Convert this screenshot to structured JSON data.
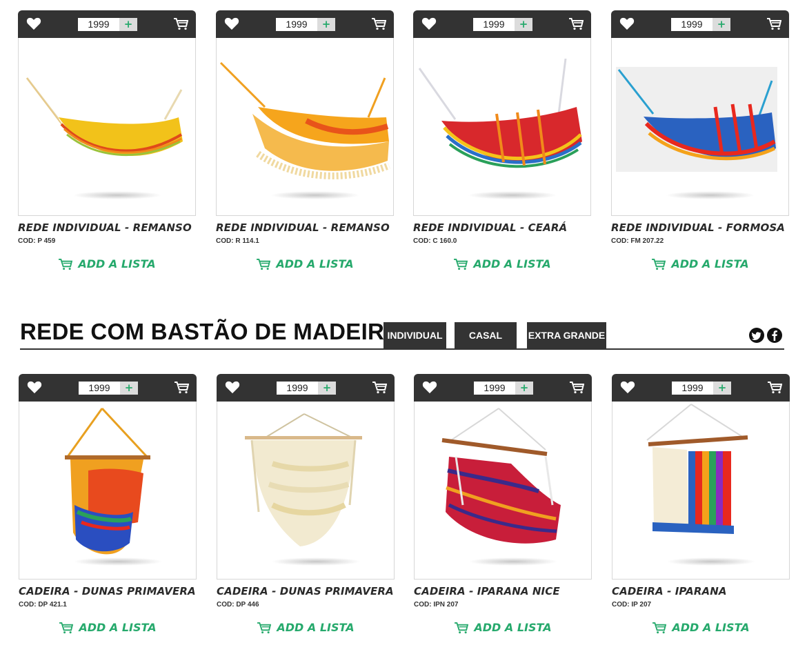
{
  "colors": {
    "accent": "#26a96c",
    "dark_bar": "#333333"
  },
  "row1": [
    {
      "qty": "1999",
      "title": "REDE INDIVIDUAL - REMANSO",
      "code": "COD: P 459",
      "add": "ADD A LISTA"
    },
    {
      "qty": "1999",
      "title": "REDE INDIVIDUAL - REMANSO",
      "code": "COD:  R 114.1",
      "add": "ADD A LISTA"
    },
    {
      "qty": "1999",
      "title": "REDE INDIVIDUAL - CEARÁ",
      "code": "COD: C 160.0",
      "add": "ADD A LISTA"
    },
    {
      "qty": "1999",
      "title": "REDE INDIVIDUAL - FORMOSA",
      "code": "COD: FM 207.22",
      "add": "ADD A LISTA"
    }
  ],
  "section": {
    "title": "REDE COM BASTÃO DE MADEIRA",
    "tabs": [
      "INDIVIDUAL",
      "CASAL",
      "EXTRA GRANDE"
    ],
    "social": [
      "twitter-icon",
      "facebook-icon"
    ]
  },
  "row2": [
    {
      "qty": "1999",
      "title": "CADEIRA - DUNAS PRIMAVERA",
      "code": "COD: DP 421.1",
      "add": "ADD A LISTA"
    },
    {
      "qty": "1999",
      "title": "CADEIRA - DUNAS PRIMAVERA",
      "code": "COD: DP 446",
      "add": "ADD A LISTA"
    },
    {
      "qty": "1999",
      "title": "CADEIRA - IPARANA NICE",
      "code": "COD: IPN 207",
      "add": "ADD A LISTA"
    },
    {
      "qty": "1999",
      "title": "CADEIRA - IPARANA",
      "code": "COD: IP 207",
      "add": "ADD A LISTA"
    }
  ],
  "icons": {
    "favorite": "heart-icon",
    "cart": "cart-icon",
    "plus": "plus-icon"
  }
}
